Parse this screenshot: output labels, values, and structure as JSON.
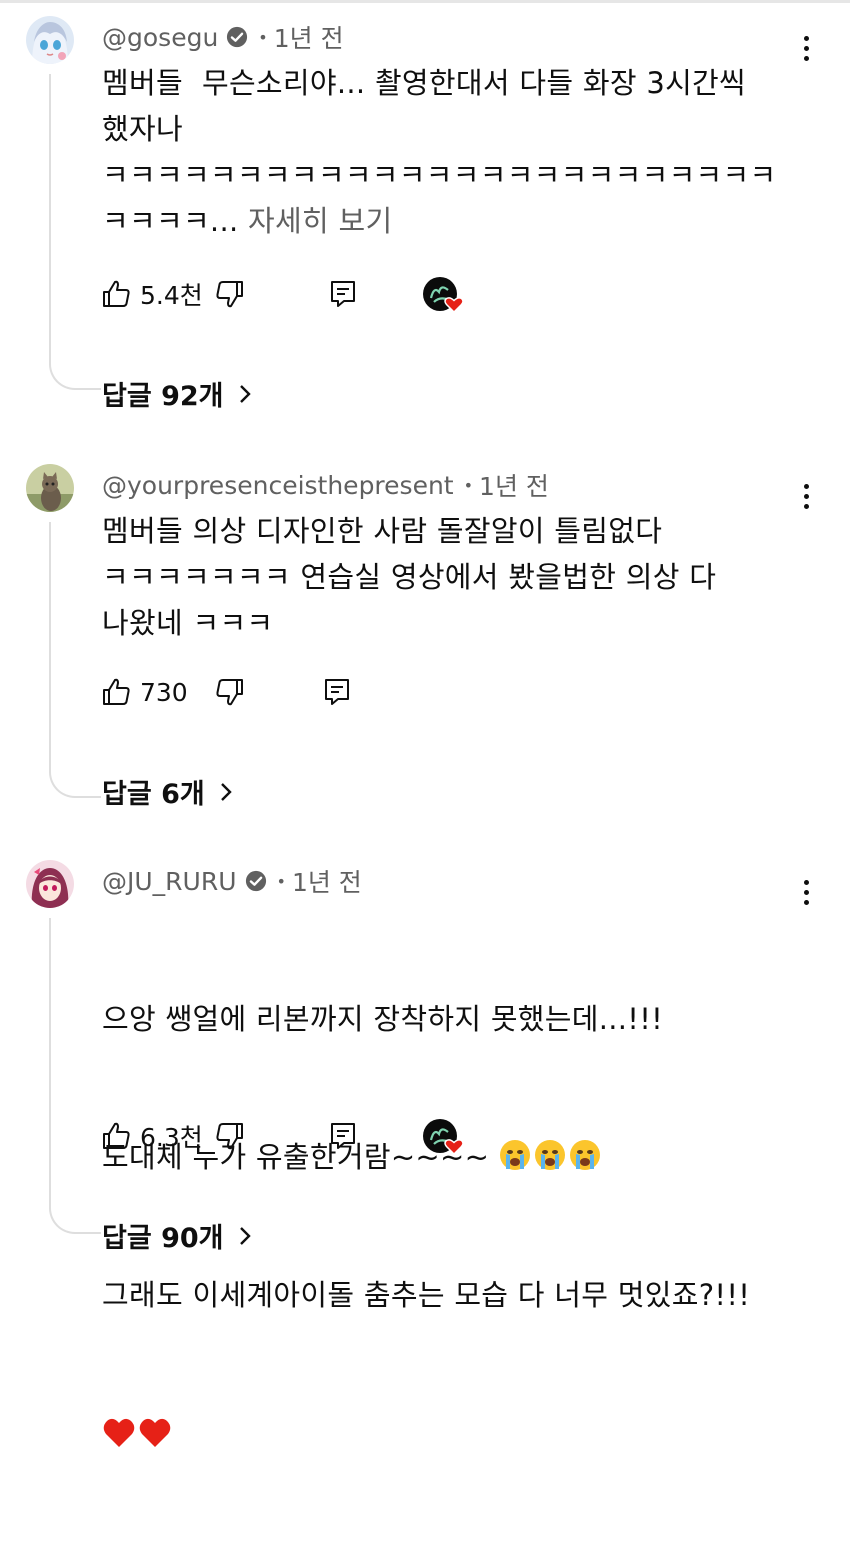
{
  "comments": [
    {
      "handle": "@gosegu",
      "verified": true,
      "time": "1년 전",
      "text": "멤버들  무슨소리야... 촬영한대서 다들 화장 3시간씩\n했자나\nㅋㅋㅋㅋㅋㅋㅋㅋㅋㅋㅋㅋㅋㅋㅋㅋㅋㅋㅋㅋㅋㅋㅋㅋㅋ\nㅋㅋㅋㅋ... ",
      "more": "자세히 보기",
      "likes": "5.4천",
      "creator_heart": true,
      "replies": "답글 92개"
    },
    {
      "handle": "@yourpresenceisthepresent",
      "verified": false,
      "time": "1년 전",
      "text": "멤버들 의상 디자인한 사람 돌잘알이 틀림없다\nㅋㅋㅋㅋㅋㅋㅋ 연습실 영상에서 봤을법한 의상 다\n나왔네 ㅋㅋㅋ",
      "likes": "730",
      "creator_heart": false,
      "replies": "답글 6개"
    },
    {
      "handle": "@JU_RURU",
      "verified": true,
      "time": "1년 전",
      "line1": "으앙 쌩얼에 리본까지 장착하지 못했는데...!!!",
      "line2": "도대체 누가 유출한거람~~~~ ",
      "line3": "그래도 이세계아이돌 춤추는 모습 다 너무 멋있죠?!!!",
      "emoji_line2": [
        "loudly-crying-face",
        "loudly-crying-face",
        "loudly-crying-face"
      ],
      "emoji_line4": [
        "red-heart",
        "red-heart"
      ],
      "likes": "6.3천",
      "creator_heart": true,
      "replies": "답글 90개"
    }
  ],
  "colors": {
    "text": "#0f0f0f",
    "secondary": "#606060",
    "heart": "#e62117"
  }
}
